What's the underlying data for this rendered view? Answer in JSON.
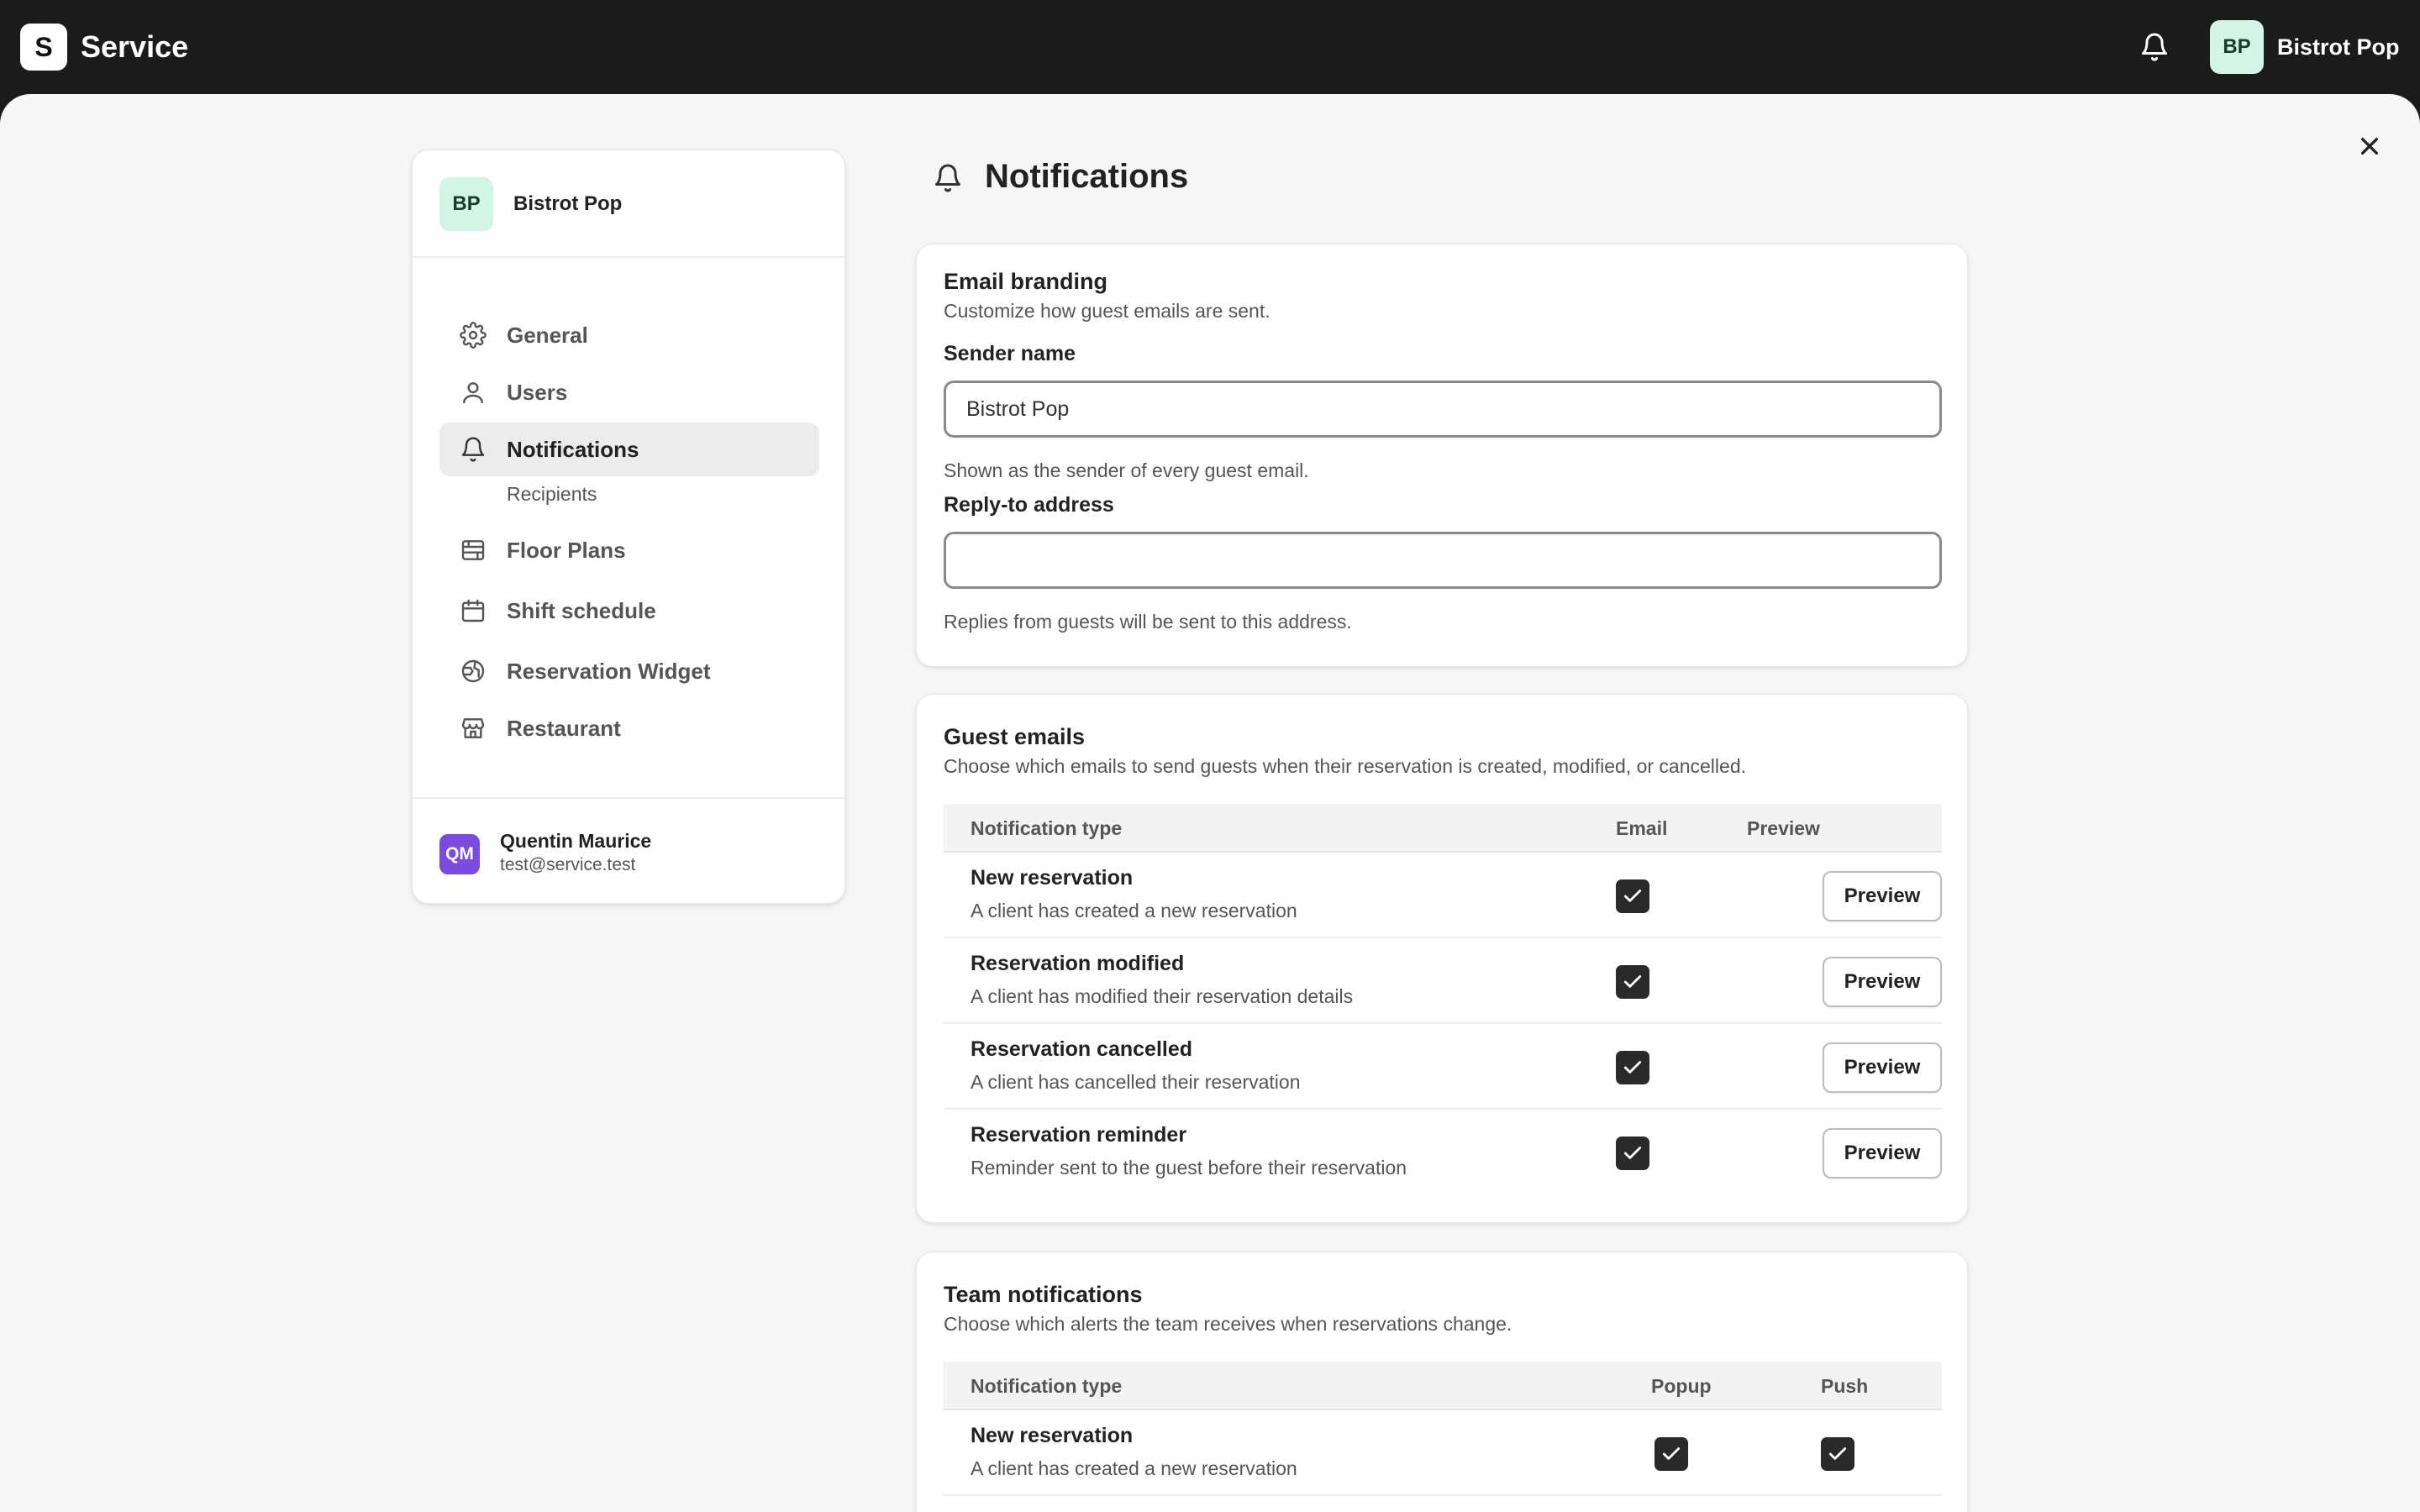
{
  "app": {
    "logo_letter": "S",
    "title": "Service"
  },
  "user_menu": {
    "initials": "BP",
    "name": "Bistrot Pop"
  },
  "sidebar": {
    "org_initials": "BP",
    "org_name": "Bistrot Pop",
    "items": [
      {
        "label": "General",
        "icon": "gear-icon"
      },
      {
        "label": "Users",
        "icon": "user-icon"
      },
      {
        "label": "Notifications",
        "icon": "bell-icon",
        "active": true
      },
      {
        "label": "Recipients",
        "sub": true
      },
      {
        "label": "Floor Plans",
        "icon": "floor-plan-icon"
      },
      {
        "label": "Shift schedule",
        "icon": "calendar-icon"
      },
      {
        "label": "Reservation Widget",
        "icon": "globe-icon"
      },
      {
        "label": "Restaurant",
        "icon": "store-icon"
      }
    ],
    "footer": {
      "initials": "QM",
      "name": "Quentin Maurice",
      "email": "test@service.test"
    }
  },
  "page": {
    "title": "Notifications"
  },
  "email_branding": {
    "title": "Email branding",
    "description": "Customize how guest emails are sent.",
    "sender_label": "Sender name",
    "sender_value": "Bistrot Pop",
    "sender_hint": "Shown as the sender of every guest email.",
    "reply_label": "Reply-to address",
    "reply_value": "",
    "reply_hint": "Replies from guests will be sent to this address."
  },
  "guest_emails": {
    "title": "Guest emails",
    "description": "Choose which emails to send guests when their reservation is created, modified, or cancelled.",
    "columns": [
      "Notification type",
      "Email",
      "Preview"
    ],
    "preview_label": "Preview",
    "rows": [
      {
        "title": "New reservation",
        "desc": "A client has created a new reservation",
        "email": true
      },
      {
        "title": "Reservation modified",
        "desc": "A client has modified their reservation details",
        "email": true
      },
      {
        "title": "Reservation cancelled",
        "desc": "A client has cancelled their reservation",
        "email": true
      },
      {
        "title": "Reservation reminder",
        "desc": "Reminder sent to the guest before their reservation",
        "email": true
      }
    ]
  },
  "team_notifications": {
    "title": "Team notifications",
    "description": "Choose which alerts the team receives when reservations change.",
    "columns": [
      "Notification type",
      "Popup",
      "Push"
    ],
    "rows": [
      {
        "title": "New reservation",
        "desc": "A client has created a new reservation",
        "popup": true,
        "push": true
      }
    ]
  }
}
